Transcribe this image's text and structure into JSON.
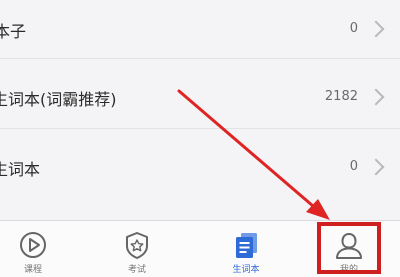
{
  "list": {
    "rows": [
      {
        "label": "本子",
        "count": "0"
      },
      {
        "label": "生词本(词霸推荐)",
        "count": "2182"
      },
      {
        "label": "生词本",
        "count": "0"
      }
    ]
  },
  "tabbar": {
    "tabs": [
      {
        "label": "课程",
        "icon": "play-circle-icon"
      },
      {
        "label": "考试",
        "icon": "shield-star-icon"
      },
      {
        "label": "生词本",
        "icon": "wordbook-icon",
        "active": true
      },
      {
        "label": "我的",
        "icon": "person-icon"
      }
    ]
  },
  "colors": {
    "accent": "#2e6bd6",
    "annotation_red": "#cf1f1f"
  }
}
